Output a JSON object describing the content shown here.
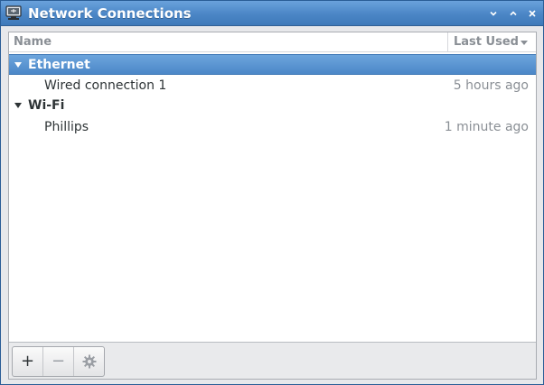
{
  "window": {
    "title": "Network Connections",
    "controls": [
      "minimize",
      "maximize",
      "close"
    ]
  },
  "list": {
    "columns": {
      "name": "Name",
      "last_used": "Last Used"
    },
    "groups": [
      {
        "label": "Ethernet",
        "selected": true,
        "expanded": true,
        "items": [
          {
            "name": "Wired connection 1",
            "last_used": "5 hours ago"
          }
        ]
      },
      {
        "label": "Wi-Fi",
        "selected": false,
        "expanded": true,
        "items": [
          {
            "name": "Phillips",
            "last_used": "1 minute ago"
          }
        ]
      }
    ]
  },
  "toolbar": {
    "add_label": "+",
    "remove_label": "−",
    "settings_icon": "gear-icon"
  },
  "colors": {
    "titlebar": "#4b86c6",
    "selection": "#5a96d3",
    "muted_text": "#8a8f95"
  }
}
